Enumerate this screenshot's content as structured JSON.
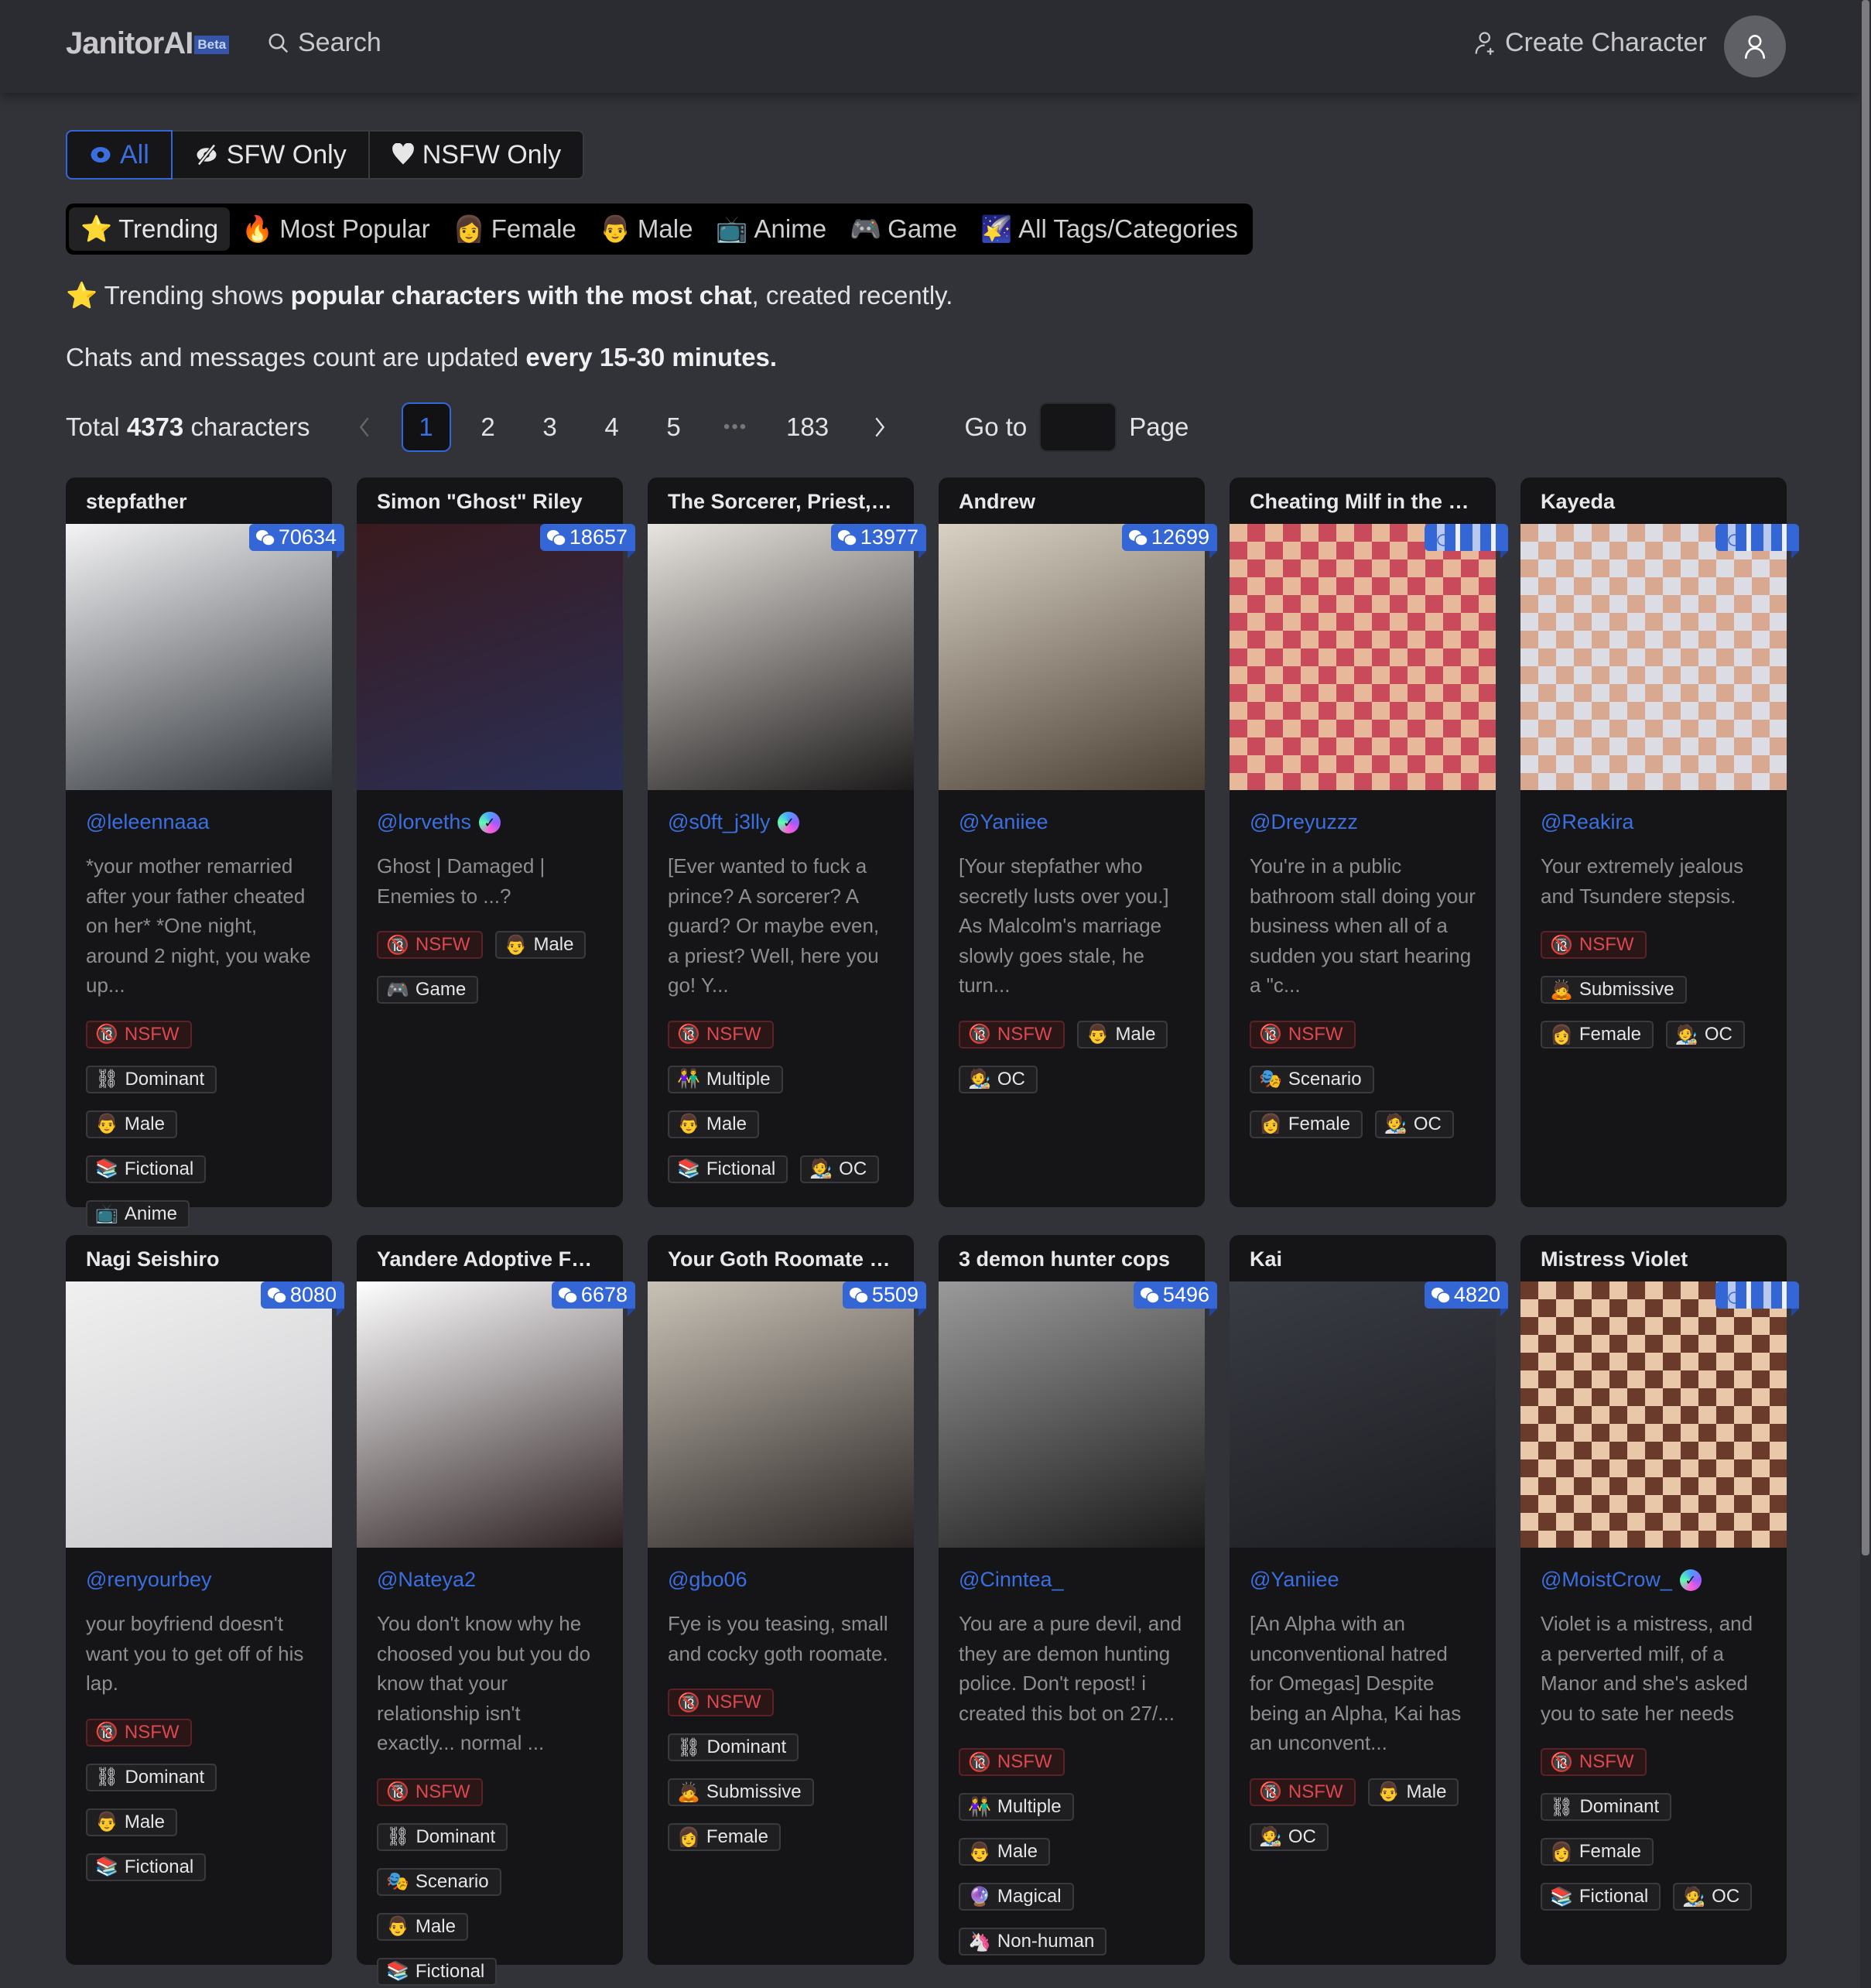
{
  "header": {
    "logo": "JanitorAI",
    "beta": "Beta",
    "search_label": "Search",
    "create_label": "Create Character"
  },
  "filters": {
    "rating": [
      {
        "label": "All",
        "icon": "eye-icon",
        "active": true
      },
      {
        "label": "SFW Only",
        "icon": "eye-slash-icon",
        "active": false
      },
      {
        "label": "NSFW Only",
        "icon": "heart-icon",
        "active": false
      }
    ],
    "categories": [
      {
        "emoji": "⭐",
        "label": "Trending",
        "active": true
      },
      {
        "emoji": "🔥",
        "label": "Most Popular"
      },
      {
        "emoji": "👩",
        "label": "Female"
      },
      {
        "emoji": "👨",
        "label": "Male"
      },
      {
        "emoji": "📺",
        "label": "Anime"
      },
      {
        "emoji": "🎮",
        "label": "Game"
      },
      {
        "emoji": "🌠",
        "label": "All Tags/Categories"
      }
    ]
  },
  "info": {
    "emoji": "⭐",
    "line1_pre": "Trending shows ",
    "line1_bold": "popular characters with the most chat",
    "line1_post": ", created recently.",
    "line2_pre": "Chats and messages count are updated ",
    "line2_bold": "every 15-30 minutes."
  },
  "pagination": {
    "total_pre": "Total ",
    "total_count": "4373",
    "total_post": " characters",
    "pages": [
      "1",
      "2",
      "3",
      "4",
      "5"
    ],
    "current": "1",
    "ellipsis": "•••",
    "last": "183",
    "goto_label": "Go to",
    "goto_value": "",
    "page_label": "Page"
  },
  "characters": [
    {
      "name": "stepfather",
      "chats": "70634",
      "creator": "@leleennaaa",
      "verified": false,
      "img": [
        "#f4f4f6",
        "#2f3338"
      ],
      "desc": "*your mother remarried after your father cheated on her* *One night, around 2 night, you wake up...",
      "tags": [
        [
          "🔞",
          "NSFW"
        ],
        [
          "⛓",
          "Dominant"
        ],
        [
          "👨",
          "Male"
        ],
        [
          "📚",
          "Fictional"
        ],
        [
          "📺",
          "Anime"
        ]
      ],
      "layout": [
        [
          0
        ],
        [
          1
        ],
        [
          2
        ],
        [
          3
        ],
        [
          4
        ]
      ]
    },
    {
      "name": "Simon \"Ghost\" Riley",
      "chats": "18657",
      "creator": "@lorveths",
      "verified": true,
      "img": [
        "#3a1a1e",
        "#2a2f55"
      ],
      "desc": "Ghost | Damaged | Enemies to ...?",
      "tags": [
        [
          "🔞",
          "NSFW"
        ],
        [
          "👨",
          "Male"
        ],
        [
          "🎮",
          "Game"
        ]
      ],
      "layout": [
        [
          0,
          1
        ],
        [
          2
        ]
      ]
    },
    {
      "name": "The Sorcerer, Priest, ...",
      "chats": "13977",
      "creator": "@s0ft_j3lly",
      "verified": true,
      "img": [
        "#e8e4df",
        "#1c1a1a"
      ],
      "desc": "[Ever wanted to fuck a prince? A sorcerer? A guard? Or maybe even, a priest? Well, here you go! Y...",
      "tags": [
        [
          "🔞",
          "NSFW"
        ],
        [
          "👫",
          "Multiple"
        ],
        [
          "👨",
          "Male"
        ],
        [
          "📚",
          "Fictional"
        ],
        [
          "🧑‍🎨",
          "OC"
        ]
      ],
      "layout": [
        [
          0
        ],
        [
          1
        ],
        [
          2
        ],
        [
          3,
          4
        ]
      ]
    },
    {
      "name": "Andrew",
      "chats": "12699",
      "creator": "@Yaniiee",
      "verified": false,
      "img": [
        "#d9d2c4",
        "#4a3f33"
      ],
      "desc": "[Your stepfather who secretly lusts over you.] As Malcolm's marriage slowly goes stale, he turn...",
      "tags": [
        [
          "🔞",
          "NSFW"
        ],
        [
          "👨",
          "Male"
        ],
        [
          "🧑‍🎨",
          "OC"
        ]
      ],
      "layout": [
        [
          0,
          1
        ],
        [
          2
        ]
      ]
    },
    {
      "name": "Cheating Milf in the B...",
      "chats": "",
      "chats_obscured": true,
      "creator": "@Dreyuzzz",
      "verified": false,
      "img": [
        "#c94a5a",
        "#e8b89a"
      ],
      "desc": "You're in a public bathroom stall doing your business when all of a sudden you start hearing a \"c...",
      "tags": [
        [
          "🔞",
          "NSFW"
        ],
        [
          "🎭",
          "Scenario"
        ],
        [
          "👩",
          "Female"
        ],
        [
          "🧑‍🎨",
          "OC"
        ]
      ],
      "layout": [
        [
          0
        ],
        [
          1
        ],
        [
          2,
          3
        ]
      ]
    },
    {
      "name": "Kayeda",
      "chats": "",
      "chats_obscured": true,
      "creator": "@Reakira",
      "verified": false,
      "img": [
        "#dcdce4",
        "#d8a890"
      ],
      "desc": "Your extremely jealous and Tsundere stepsis.",
      "tags": [
        [
          "🔞",
          "NSFW"
        ],
        [
          "🙇",
          "Submissive"
        ],
        [
          "👩",
          "Female"
        ],
        [
          "🧑‍🎨",
          "OC"
        ]
      ],
      "layout": [
        [
          0
        ],
        [
          1
        ],
        [
          2,
          3
        ]
      ]
    },
    {
      "name": "Nagi Seishiro",
      "chats": "8080",
      "creator": "@renyourbey",
      "verified": false,
      "img": [
        "#f0f0f0",
        "#c8c8cc"
      ],
      "desc": "your boyfriend doesn't want you to get off of his lap.",
      "tags": [
        [
          "🔞",
          "NSFW"
        ],
        [
          "⛓",
          "Dominant"
        ],
        [
          "👨",
          "Male"
        ],
        [
          "📚",
          "Fictional"
        ]
      ],
      "layout": [
        [
          0
        ],
        [
          1
        ],
        [
          2
        ],
        [
          3
        ]
      ]
    },
    {
      "name": "Yandere Adoptive Fat...",
      "chats": "6678",
      "creator": "@Nateya2",
      "verified": false,
      "img": [
        "#ffffff",
        "#2a1e20"
      ],
      "desc": "You don't know why he choosed you but you do know that your relationship isn't exactly... normal ...",
      "tags": [
        [
          "🔞",
          "NSFW"
        ],
        [
          "⛓",
          "Dominant"
        ],
        [
          "🎭",
          "Scenario"
        ],
        [
          "👨",
          "Male"
        ],
        [
          "📚",
          "Fictional"
        ]
      ],
      "layout": [
        [
          0
        ],
        [
          1
        ],
        [
          2
        ],
        [
          3
        ],
        [
          4
        ]
      ]
    },
    {
      "name": "Your Goth Roomate Fye",
      "chats": "5509",
      "creator": "@gbo06",
      "verified": false,
      "img": [
        "#c8c2b6",
        "#2a2424"
      ],
      "desc": "Fye is you teasing, small and cocky goth roomate.",
      "tags": [
        [
          "🔞",
          "NSFW"
        ],
        [
          "⛓",
          "Dominant"
        ],
        [
          "🙇",
          "Submissive"
        ],
        [
          "👩",
          "Female"
        ]
      ],
      "layout": [
        [
          0
        ],
        [
          1
        ],
        [
          2
        ],
        [
          3
        ]
      ]
    },
    {
      "name": "3 demon hunter cops",
      "chats": "5496",
      "creator": "@Cinntea_",
      "verified": false,
      "img": [
        "#9a9a9a",
        "#1a1a1a"
      ],
      "desc": "You are a pure devil, and they are demon hunting police. Don't repost! i created this bot on 27/...",
      "tags": [
        [
          "🔞",
          "NSFW"
        ],
        [
          "👫",
          "Multiple"
        ],
        [
          "👨",
          "Male"
        ],
        [
          "🔮",
          "Magical"
        ],
        [
          "🦄",
          "Non-human"
        ]
      ],
      "layout": [
        [
          0
        ],
        [
          1
        ],
        [
          2
        ],
        [
          3
        ],
        [
          4
        ]
      ]
    },
    {
      "name": "Kai",
      "chats": "4820",
      "creator": "@Yaniiee",
      "verified": false,
      "img": [
        "#3a3c44",
        "#1c1d22"
      ],
      "desc": "[An Alpha with an unconventional hatred for Omegas] Despite being an Alpha, Kai has an unconvent...",
      "tags": [
        [
          "🔞",
          "NSFW"
        ],
        [
          "👨",
          "Male"
        ],
        [
          "🧑‍🎨",
          "OC"
        ]
      ],
      "layout": [
        [
          0,
          1
        ],
        [
          2
        ]
      ]
    },
    {
      "name": "Mistress Violet",
      "chats": "",
      "chats_obscured": true,
      "creator": "@MoistCrow_",
      "verified": true,
      "img": [
        "#e8c8a8",
        "#6a3a2a"
      ],
      "desc": "Violet is a mistress, and a perverted milf, of a Manor and she's asked you to sate her needs",
      "tags": [
        [
          "🔞",
          "NSFW"
        ],
        [
          "⛓",
          "Dominant"
        ],
        [
          "👩",
          "Female"
        ],
        [
          "📚",
          "Fictional"
        ],
        [
          "🧑‍🎨",
          "OC"
        ]
      ],
      "layout": [
        [
          0
        ],
        [
          1
        ],
        [
          2
        ],
        [
          3,
          4
        ]
      ]
    }
  ]
}
